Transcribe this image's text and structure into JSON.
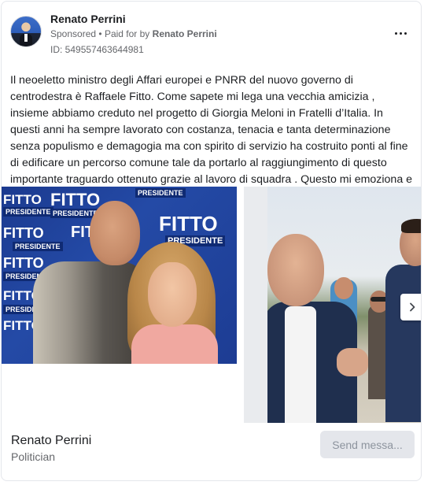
{
  "post": {
    "author": "Renato Perrini",
    "sponsored_label": "Sponsored",
    "separator": "•",
    "paid_for_label": "Paid for by",
    "paid_for_name": "Renato Perrini",
    "ad_id": "ID: 549557463644981",
    "more_icon": "more-options-icon",
    "text": "Il neoeletto ministro degli Affari europei e PNRR del nuovo governo di centrodestra è Raffaele Fitto. Come sapete mi lega una vecchia amicizia , insieme abbiamo creduto nel progetto di Giorgia Meloni in Fratelli d’Italia. In questi anni ha sempre lavorato con costanza, tenacia e tanta determinazione senza populismo e demagogia ma con spirito di servizio ha costruito ponti al fine di edificare un percorso comune tale da portarlo al raggiungimento di questo importante traguardo ottenuto grazie al lavoro di squadra . Questo mi emoziona e mi…"
  },
  "carousel": {
    "photo1_banner": {
      "fitto": "FITTO",
      "presidente": "PRESIDENTE"
    },
    "next_icon": "chevron-right-icon"
  },
  "footer": {
    "name": "Renato Perrini",
    "role": "Politician",
    "send_button": "Send messa..."
  },
  "colors": {
    "banner_blue": "#1d3c93",
    "send_bg": "#e4e6eb",
    "muted_text": "#65676b"
  }
}
